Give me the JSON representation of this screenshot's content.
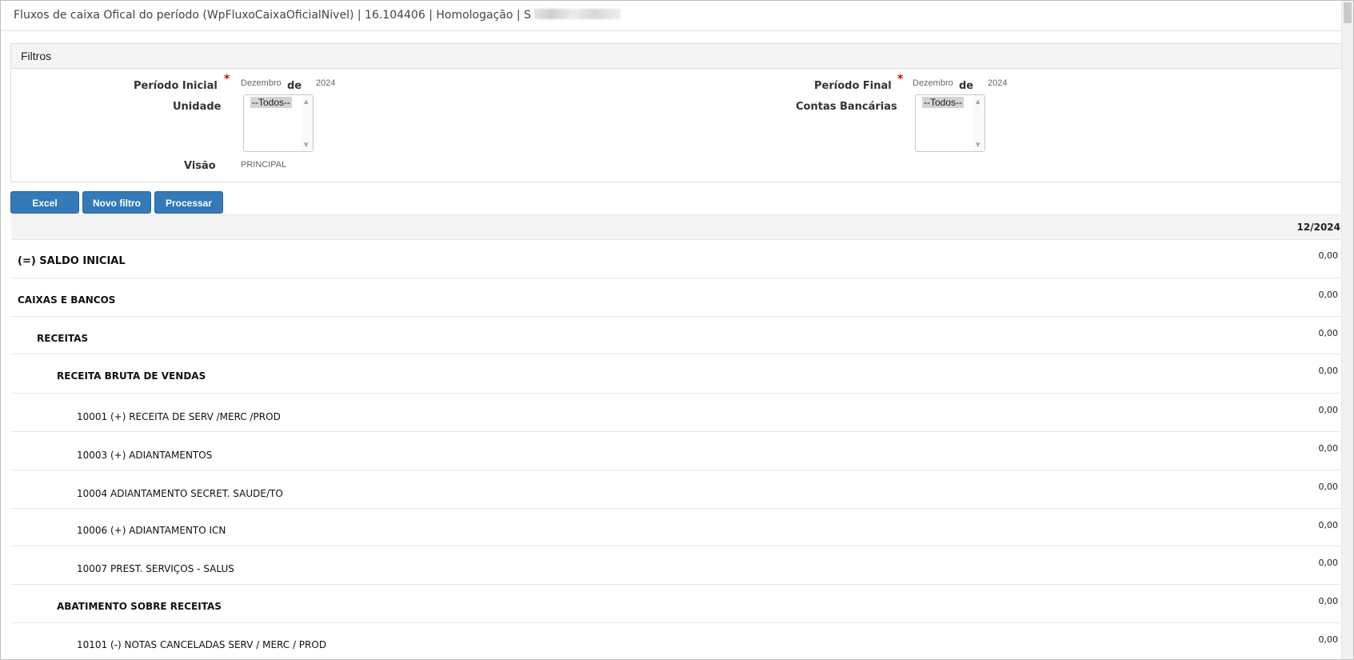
{
  "window": {
    "title": "Fluxos de caixa Ofical do período (WpFluxoCaixaOficialNivel) | 16.104406 | Homologação | S"
  },
  "filters": {
    "header": "Filtros",
    "periodo_inicial": {
      "label": "Período Inicial",
      "month": "Dezembro",
      "sep": "de",
      "year": "2024"
    },
    "periodo_final": {
      "label": "Período Final",
      "month": "Dezembro",
      "sep": "de",
      "year": "2024"
    },
    "unidade": {
      "label": "Unidade",
      "selected": "--Todos--"
    },
    "contas": {
      "label": "Contas Bancárias",
      "selected": "--Todos--"
    },
    "visao": {
      "label": "Visão",
      "value": "PRINCIPAL"
    },
    "required_mark": "*"
  },
  "buttons": {
    "excel": "Excel",
    "novo_filtro": "Novo filtro",
    "processar": "Processar"
  },
  "table": {
    "period_header": "12/2024",
    "rows": [
      {
        "label": "(=) SALDO INICIAL",
        "value": "0,00"
      },
      {
        "label": "CAIXAS E BANCOS",
        "value": "0,00"
      },
      {
        "label": "RECEITAS",
        "value": "0,00"
      },
      {
        "label": "RECEITA BRUTA DE VENDAS",
        "value": "0,00"
      },
      {
        "label": "10001 (+) RECEITA DE SERV /MERC /PROD",
        "value": "0,00"
      },
      {
        "label": "10003 (+) ADIANTAMENTOS",
        "value": "0,00"
      },
      {
        "label": "10004 ADIANTAMENTO SECRET. SAUDE/TO",
        "value": "0,00"
      },
      {
        "label": "10006 (+) ADIANTAMENTO ICN",
        "value": "0,00"
      },
      {
        "label": "10007 PREST. SERVIÇOS - SALUS",
        "value": "0,00"
      },
      {
        "label": "ABATIMENTO SOBRE RECEITAS",
        "value": "0,00"
      },
      {
        "label": "10101 (-) NOTAS CANCELADAS SERV / MERC / PROD",
        "value": "0,00"
      }
    ]
  }
}
